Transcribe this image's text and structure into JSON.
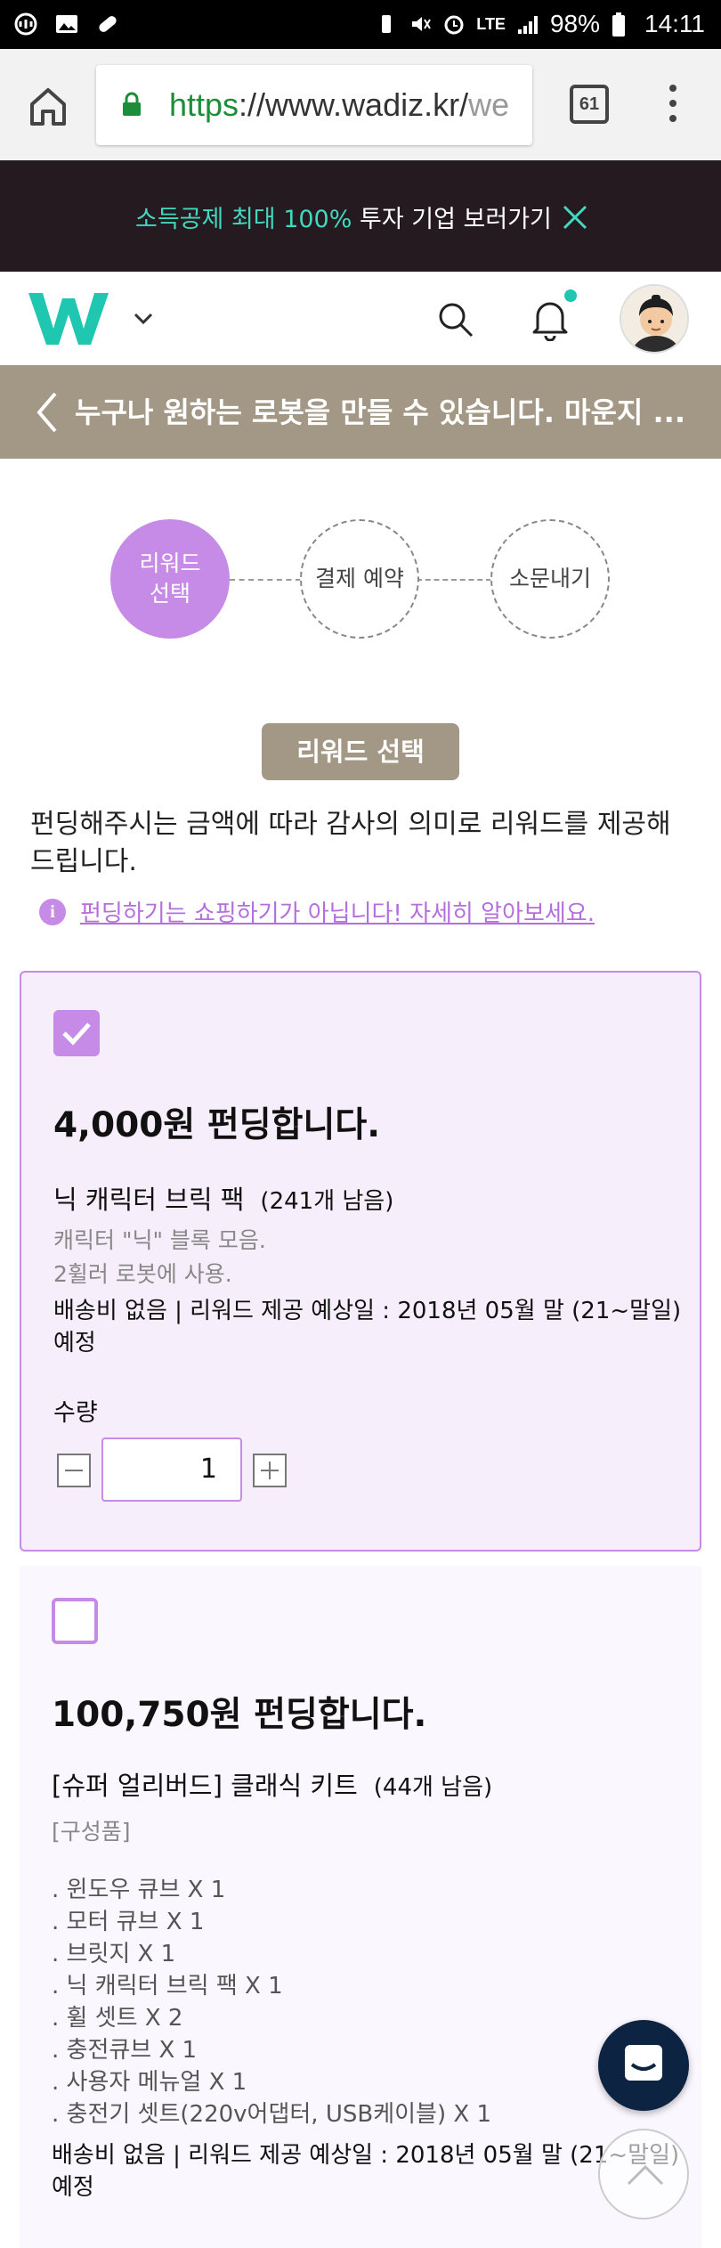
{
  "status_bar": {
    "battery": "98%",
    "time": "14:11",
    "network": "LTE"
  },
  "browser": {
    "url_scheme": "https",
    "url_host": "://www.wadiz.kr/",
    "url_rest": "we",
    "tab_count": "61"
  },
  "promo": {
    "highlight": "소득공제 최대 100%",
    "text": " 투자 기업 보러가기"
  },
  "titlebar": {
    "title": "누구나 원하는 로봇을 만들 수 있습니다. 마운지 ..."
  },
  "steps": [
    {
      "label": "리워드\n선택"
    },
    {
      "label": "결제 예약"
    },
    {
      "label": "소문내기"
    }
  ],
  "section": {
    "tag": "리워드 선택",
    "intro": "펀딩해주시는 금액에 따라 감사의 의미로 리워드를 제공해 드립니다.",
    "notice_icon": "i",
    "notice": "펀딩하기는 쇼핑하기가 아닙니다! 자세히 알아보세요."
  },
  "rewards": [
    {
      "selected": true,
      "price": "4,000원 펀딩합니다.",
      "name": "닉 캐릭터 브릭 팩",
      "remaining": "(241개 남음)",
      "description": "캐릭터 \"닉\" 블록 모음.\n2휠러 로봇에 사용.",
      "shipping": "배송비 없음 | 리워드 제공 예상일 : 2018년 05월 말 (21~말일) 예정",
      "quantity_label": "수량",
      "quantity": "1"
    },
    {
      "selected": false,
      "price": "100,750원 펀딩합니다.",
      "name": "[슈퍼 얼리버드] 클래식 키트",
      "remaining": "(44개 남음)",
      "composition_label": "[구성품]",
      "items": [
        ". 윈도우 큐브 X 1",
        ". 모터 큐브 X 1",
        ". 브릿지 X 1",
        ". 닉 캐릭터 브릭 팩 X 1",
        ". 휠 셋트 X 2",
        ". 충전큐브 X 1",
        ". 사용자 메뉴얼 X 1",
        ". 충전기 셋트(220v어댑터, USB케이블) X 1"
      ],
      "shipping": "배송비 없음 | 리워드 제공 예상일 : 2018년 05월 말 (21~말일) 예정"
    }
  ],
  "colors": {
    "accent": "#c68be6",
    "brand": "#1fc7b0",
    "titlebar": "#a39886",
    "promo_bg": "#251a1f"
  }
}
